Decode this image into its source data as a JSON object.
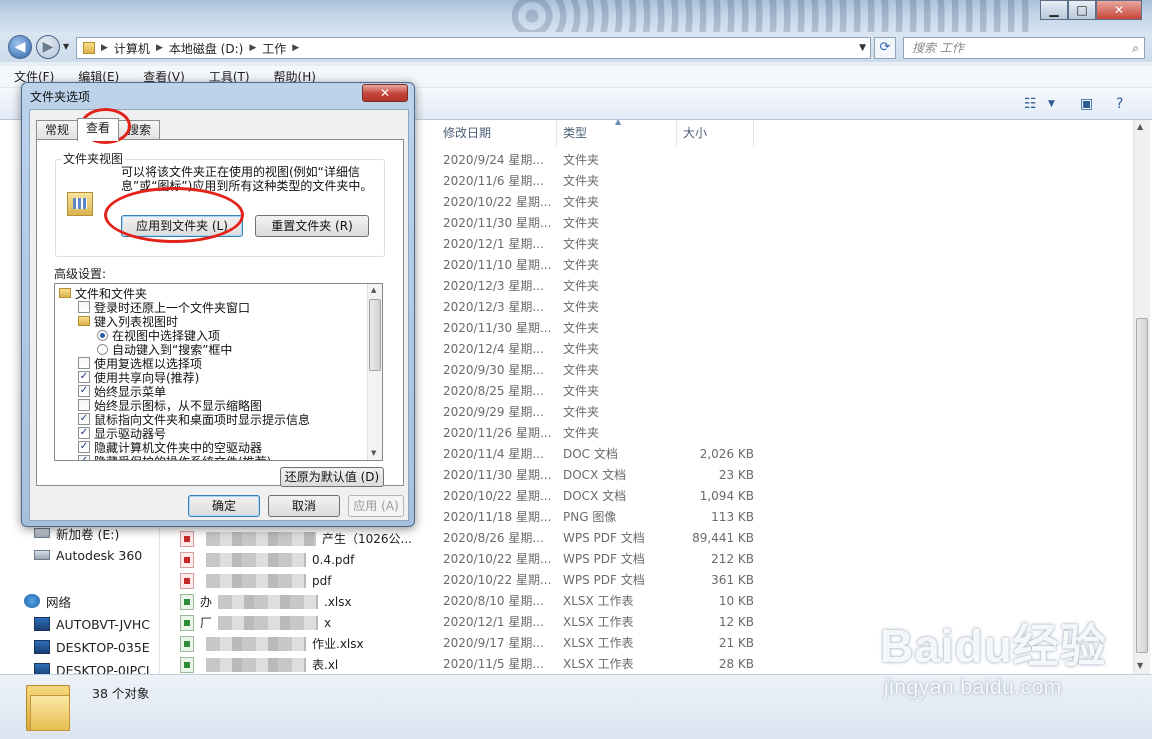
{
  "window": {
    "address": [
      "计算机",
      "本地磁盘 (D:)",
      "工作"
    ],
    "search_placeholder": "搜索 工作",
    "controls": {
      "minimize": "▁",
      "maximize": "□",
      "close": "✕"
    }
  },
  "menu": [
    "文件(F)",
    "编辑(E)",
    "查看(V)",
    "工具(T)",
    "帮助(H)"
  ],
  "nav": {
    "items": [
      {
        "label": "新加卷 (E:)",
        "icon": "drive-icon"
      },
      {
        "label": "Autodesk 360",
        "icon": "cloud-drive-icon"
      },
      {
        "label": "网络",
        "icon": "network-icon"
      },
      {
        "label": "AUTOBVT-JVHC",
        "icon": "computer-icon"
      },
      {
        "label": "DESKTOP-035E",
        "icon": "computer-icon"
      },
      {
        "label": "DESKTOP-0IPCI",
        "icon": "computer-icon"
      }
    ]
  },
  "columns": {
    "modified": "修改日期",
    "type": "类型",
    "size": "大小"
  },
  "rows": [
    {
      "date": "2020/9/24 星期...",
      "type": "文件夹",
      "size": ""
    },
    {
      "date": "2020/11/6 星期...",
      "type": "文件夹",
      "size": ""
    },
    {
      "date": "2020/10/22 星期...",
      "type": "文件夹",
      "size": ""
    },
    {
      "date": "2020/11/30 星期...",
      "type": "文件夹",
      "size": ""
    },
    {
      "date": "2020/12/1 星期...",
      "type": "文件夹",
      "size": ""
    },
    {
      "date": "2020/11/10 星期...",
      "type": "文件夹",
      "size": ""
    },
    {
      "date": "2020/12/3 星期...",
      "type": "文件夹",
      "size": ""
    },
    {
      "date": "2020/12/3 星期...",
      "type": "文件夹",
      "size": ""
    },
    {
      "date": "2020/11/30 星期...",
      "type": "文件夹",
      "size": ""
    },
    {
      "date": "2020/12/4 星期...",
      "type": "文件夹",
      "size": ""
    },
    {
      "date": "2020/9/30 星期...",
      "type": "文件夹",
      "size": ""
    },
    {
      "date": "2020/8/25 星期...",
      "type": "文件夹",
      "size": ""
    },
    {
      "date": "2020/9/29 星期...",
      "type": "文件夹",
      "size": ""
    },
    {
      "date": "2020/11/26 星期...",
      "type": "文件夹",
      "size": ""
    },
    {
      "date": "2020/11/4 星期...",
      "type": "DOC 文档",
      "size": "2,026 KB"
    },
    {
      "date": "2020/11/30 星期...",
      "type": "DOCX 文档",
      "size": "23 KB"
    },
    {
      "date": "2020/10/22 星期...",
      "type": "DOCX 文档",
      "size": "1,094 KB"
    },
    {
      "date": "2020/11/18 星期...",
      "type": "PNG 图像",
      "size": "113 KB"
    },
    {
      "date": "2020/8/26 星期...",
      "type": "WPS PDF 文档",
      "size": "89,441 KB"
    },
    {
      "date": "2020/10/22 星期...",
      "type": "WPS PDF 文档",
      "size": "212 KB"
    },
    {
      "date": "2020/10/22 星期...",
      "type": "WPS PDF 文档",
      "size": "361 KB"
    },
    {
      "date": "2020/8/10 星期...",
      "type": "XLSX 工作表",
      "size": "10 KB"
    },
    {
      "date": "2020/12/1 星期...",
      "type": "XLSX 工作表",
      "size": "12 KB"
    },
    {
      "date": "2020/9/17 星期...",
      "type": "XLSX 工作表",
      "size": "21 KB"
    },
    {
      "date": "2020/11/5 星期...",
      "type": "XLSX 工作表",
      "size": "28 KB"
    }
  ],
  "visible_names": [
    {
      "pre": "",
      "post": "产生（1026公...",
      "icon": "pdf"
    },
    {
      "pre": "",
      "post": "0.4.pdf",
      "icon": "pdf"
    },
    {
      "pre": "",
      "post": "pdf",
      "icon": "pdf"
    },
    {
      "pre": "办",
      "post": ".xlsx",
      "icon": "xls"
    },
    {
      "pre": "厂",
      "post": "x",
      "icon": "xls"
    },
    {
      "pre": "",
      "post": "作业.xlsx",
      "icon": "xls"
    },
    {
      "pre": "",
      "post": "表.xl",
      "icon": "xls"
    }
  ],
  "status": {
    "count": "38 个对象"
  },
  "watermark": {
    "brand": "Bai",
    "brand2": "du经验",
    "url": "jingyan.baidu.com"
  },
  "dialog": {
    "title": "文件夹选项",
    "close": "✕",
    "tabs": [
      "常规",
      "查看",
      "搜索"
    ],
    "folder_views": {
      "title": "文件夹视图",
      "description": "可以将该文件夹正在使用的视图(例如“详细信息”或“图标”)应用到所有这种类型的文件夹中。",
      "apply": "应用到文件夹 (L)",
      "reset": "重置文件夹 (R)"
    },
    "advanced_label": "高级设置:",
    "tree": [
      {
        "kind": "folder",
        "label": "文件和文件夹",
        "indent": 0
      },
      {
        "kind": "check",
        "label": "登录时还原上一个文件夹窗口",
        "indent": 1,
        "checked": false
      },
      {
        "kind": "folder",
        "label": "键入列表视图时",
        "indent": 1
      },
      {
        "kind": "radio",
        "label": "在视图中选择键入项",
        "indent": 2,
        "checked": true
      },
      {
        "kind": "radio",
        "label": "自动键入到“搜索”框中",
        "indent": 2,
        "checked": false
      },
      {
        "kind": "check",
        "label": "使用复选框以选择项",
        "indent": 1,
        "checked": false
      },
      {
        "kind": "check",
        "label": "使用共享向导(推荐)",
        "indent": 1,
        "checked": true
      },
      {
        "kind": "check",
        "label": "始终显示菜单",
        "indent": 1,
        "checked": true
      },
      {
        "kind": "check",
        "label": "始终显示图标，从不显示缩略图",
        "indent": 1,
        "checked": false
      },
      {
        "kind": "check",
        "label": "鼠标指向文件夹和桌面项时显示提示信息",
        "indent": 1,
        "checked": true
      },
      {
        "kind": "check",
        "label": "显示驱动器号",
        "indent": 1,
        "checked": true
      },
      {
        "kind": "check",
        "label": "隐藏计算机文件夹中的空驱动器",
        "indent": 1,
        "checked": true
      },
      {
        "kind": "check",
        "label": "隐藏受保护的操作系统文件(推荐)",
        "indent": 1,
        "checked": true
      }
    ],
    "restore_defaults": "还原为默认值 (D)",
    "ok": "确定",
    "cancel": "取消",
    "apply": "应用 (A)"
  },
  "annotation_color": "#e3221a"
}
